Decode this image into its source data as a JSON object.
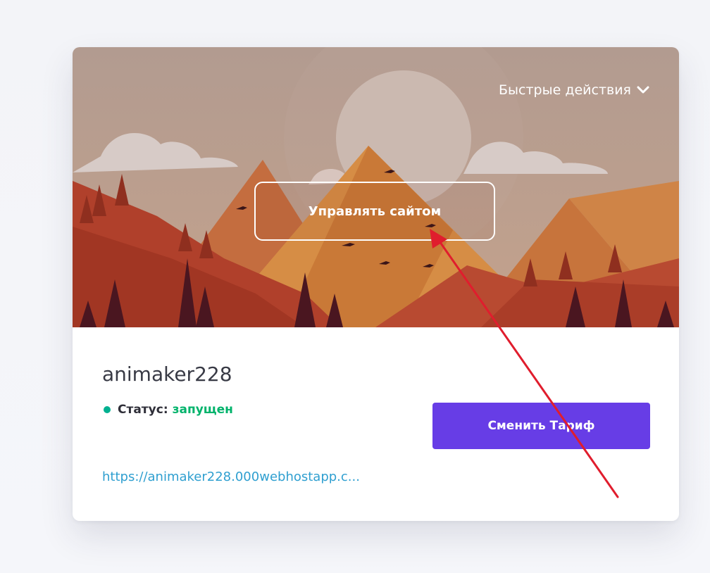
{
  "card": {
    "quick_actions_label": "Быстрые действия",
    "manage_button_label": "Управлять сайтом",
    "site_name": "animaker228",
    "status_label": "Статус:",
    "status_value": "запущен",
    "change_plan_label": "Сменить Тариф",
    "site_url": "https://animaker228.000webhostapp.c..."
  },
  "colors": {
    "accent_purple": "#673de6",
    "status_green": "#00b36b",
    "link_blue": "#2f9fd0",
    "annotation_arrow": "#e01d2d"
  },
  "icons": {
    "quick_actions": "chevron-down-icon",
    "status": "status-dot-icon",
    "annotation": "red-arrow-annotation"
  }
}
